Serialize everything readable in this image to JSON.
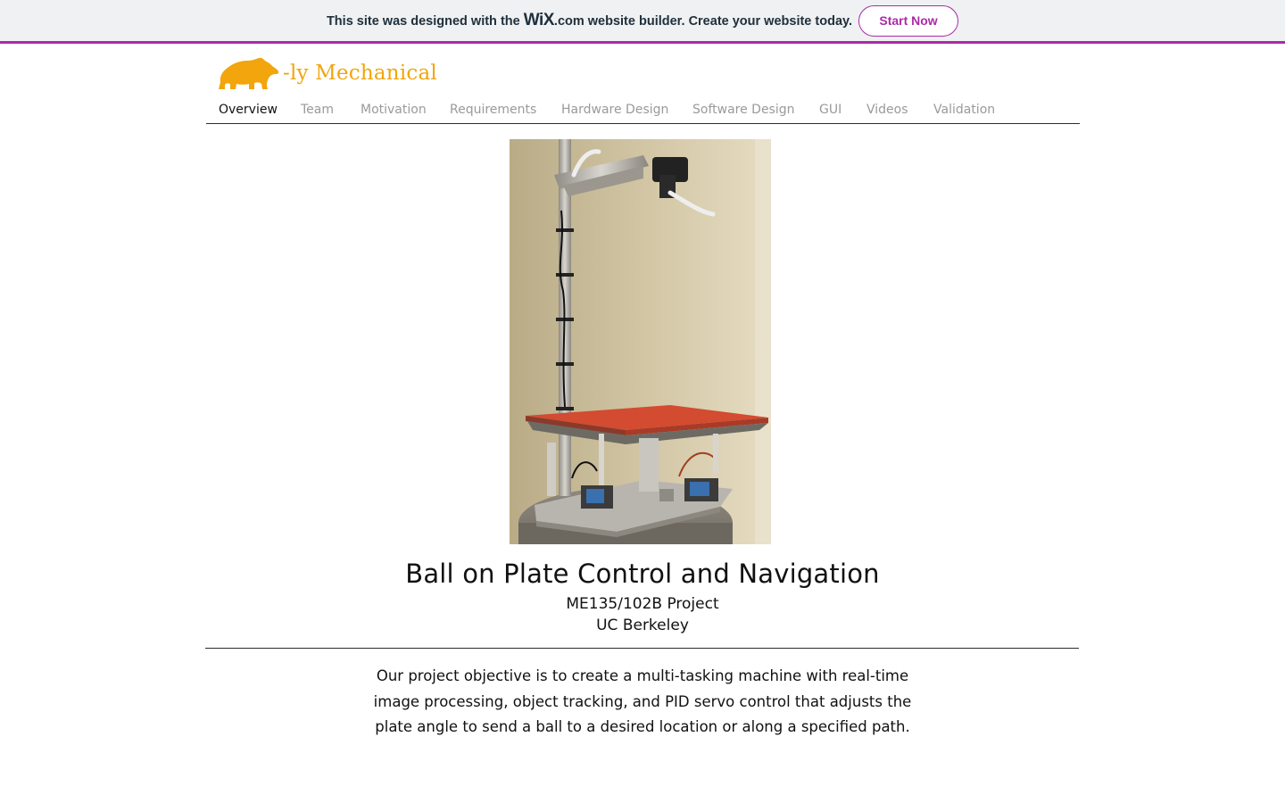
{
  "banner": {
    "prefix": "This site was designed with the",
    "wix_logo": "WiX",
    "wix_dotcom": ".com",
    "suffix": "website builder. Create your website today.",
    "cta": "Start Now",
    "accent_color": "#aa2ba7"
  },
  "header": {
    "logo_icon": "bear-icon",
    "logo_text": "-ly Mechanical",
    "logo_color": "#f2a50c"
  },
  "nav": {
    "items": [
      {
        "label": "Overview",
        "active": true
      },
      {
        "label": "Team"
      },
      {
        "label": "Motivation"
      },
      {
        "label": "Requirements"
      },
      {
        "label": "Hardware Design"
      },
      {
        "label": "Software Design"
      },
      {
        "label": "GUI"
      },
      {
        "label": "Videos"
      },
      {
        "label": "Validation"
      }
    ]
  },
  "main": {
    "image_subject": "ball-on-plate-rig-photo",
    "title": "Ball on Plate Control and Navigation",
    "subtitle_line1": "ME135/102B Project",
    "subtitle_line2": "UC Berkeley",
    "objective": "Our project objective is to create a multi-tasking machine with real-time image processing, object tracking, and PID servo control that adjusts the plate angle to send a ball to a desired location or along a specified path."
  }
}
